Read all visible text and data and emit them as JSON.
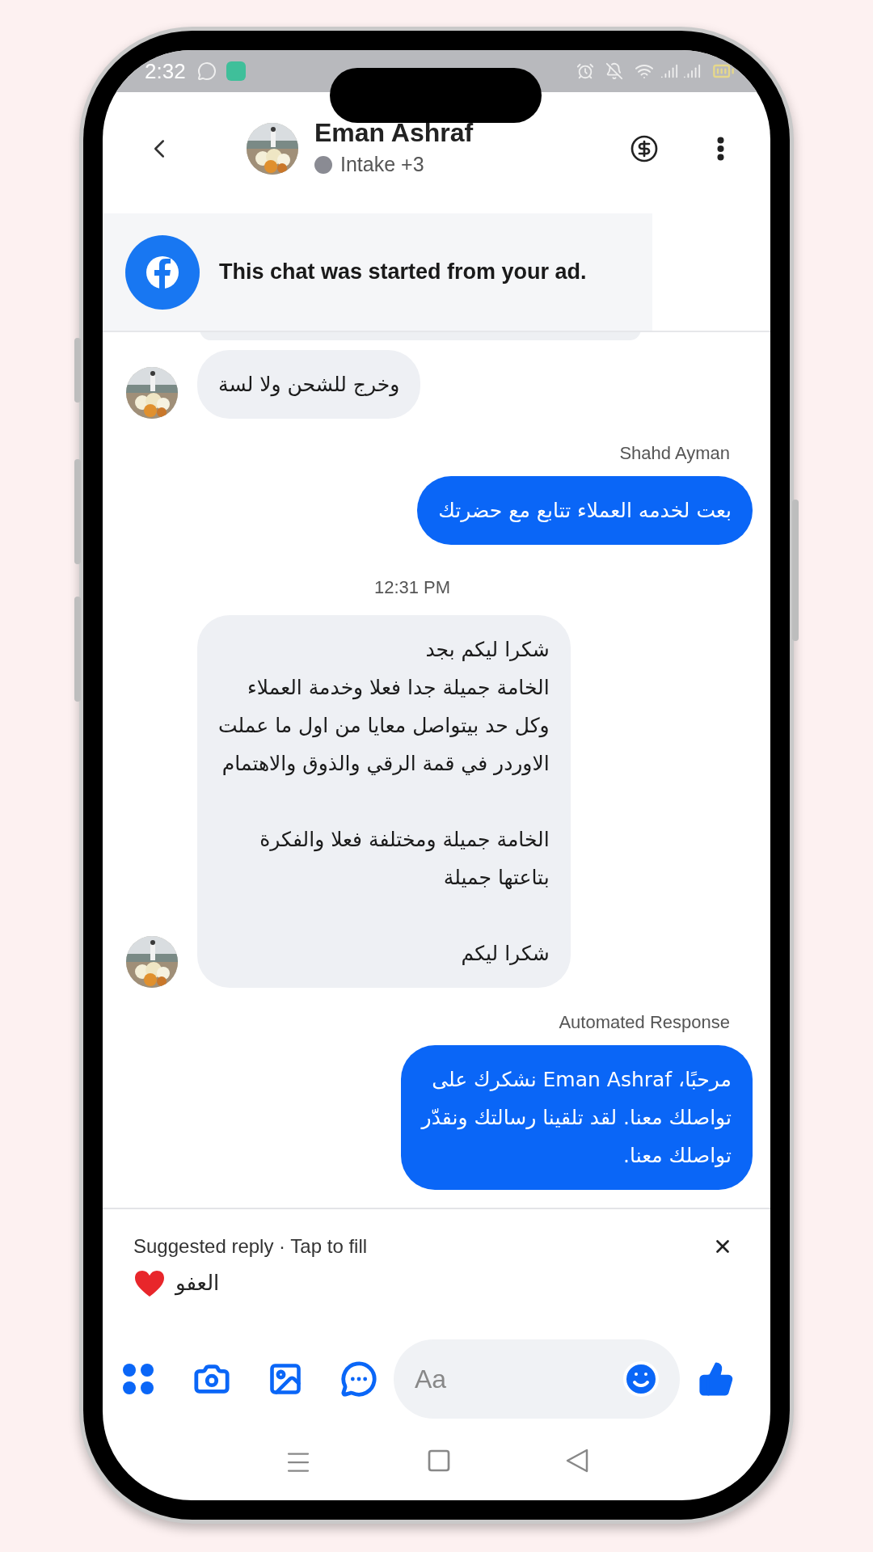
{
  "status_bar": {
    "time": "2:32"
  },
  "header": {
    "name": "Eman Ashraf",
    "label": "Intake +3"
  },
  "ad_banner": {
    "text": "This chat was started from your ad."
  },
  "messages": [
    {
      "kind": "clipped"
    },
    {
      "kind": "incoming",
      "paragraphs": [
        [
          "وخرج للشحن ولا لسة"
        ]
      ]
    },
    {
      "kind": "outgoing",
      "sender": "Shahd Ayman",
      "paragraphs": [
        [
          "بعت لخدمه العملاء تتابع مع حضرتك"
        ]
      ]
    },
    {
      "kind": "time",
      "text": "12:31 PM"
    },
    {
      "kind": "incoming",
      "paragraphs": [
        [
          "شكرا ليكم بجد",
          "الخامة جميلة جدا فعلا وخدمة العملاء",
          "وكل حد بيتواصل معايا من اول ما عملت",
          "الاوردر في قمة الرقي والذوق والاهتمام"
        ],
        [
          "الخامة جميلة ومختلفة فعلا والفكرة",
          "بتاعتها جميلة"
        ],
        [
          "شكرا ليكم"
        ]
      ]
    },
    {
      "kind": "outgoing",
      "sender": "Automated Response",
      "paragraphs": [
        [
          "مرحبًا، Eman Ashraf نشكرك على",
          "تواصلك معنا. لقد تلقينا رسالتك ونقدّر",
          "تواصلك معنا."
        ]
      ]
    }
  ],
  "suggestion": {
    "label": "Suggested reply · Tap to fill",
    "reply": "العفو"
  },
  "composer": {
    "placeholder": "Aa"
  }
}
